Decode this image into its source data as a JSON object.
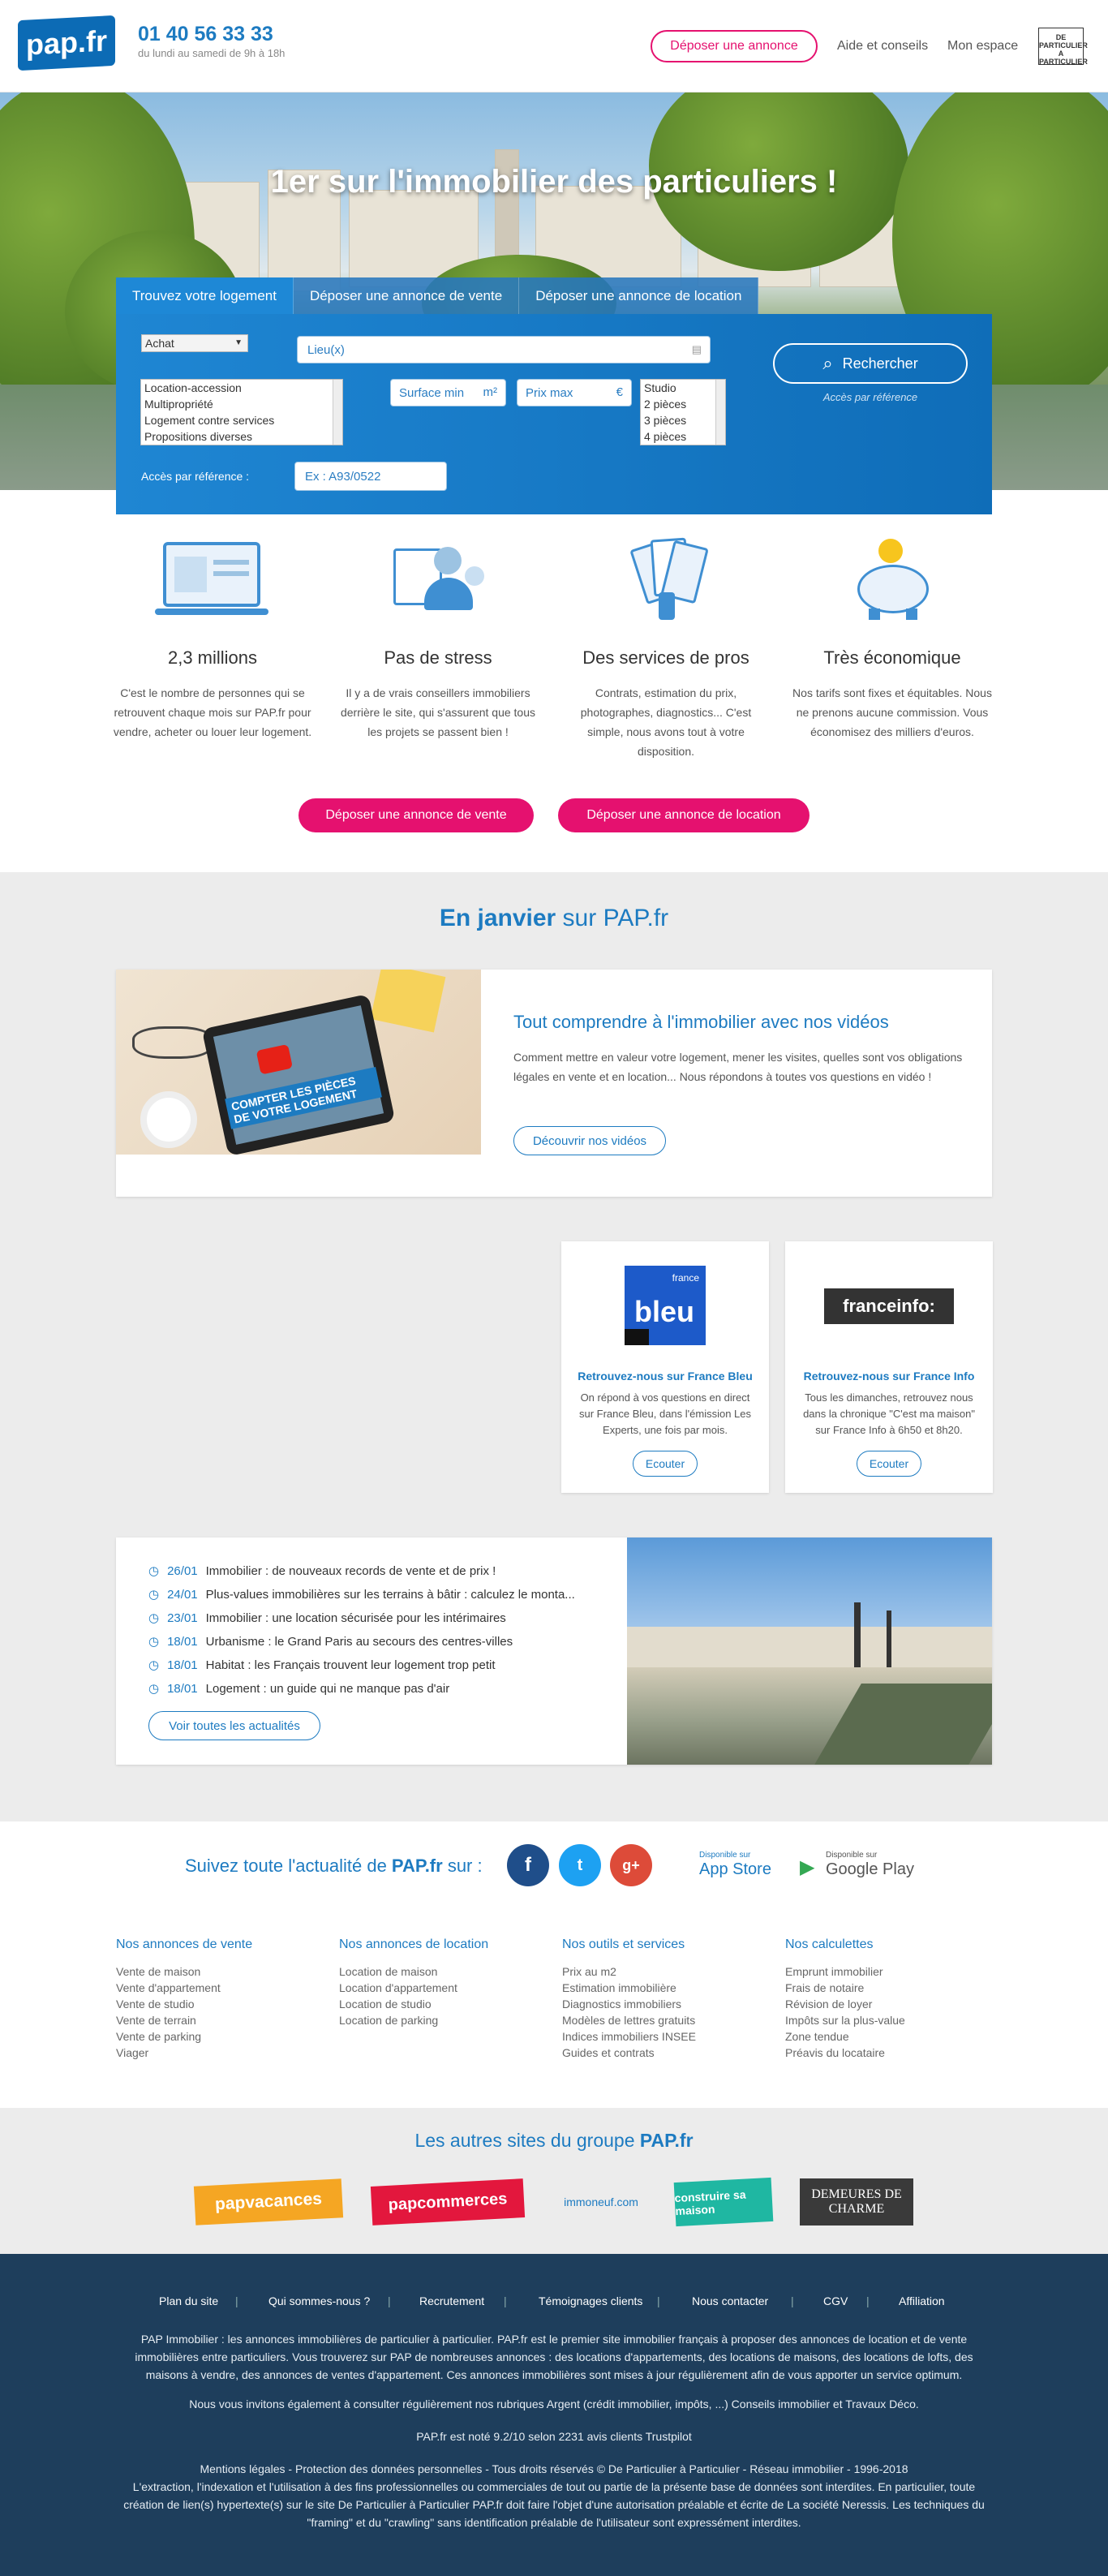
{
  "header": {
    "logo": "pap.fr",
    "phone": "01 40 56 33 33",
    "hours": "du lundi au samedi de 9h à 18h",
    "cta": "Déposer une annonce",
    "nav": [
      "Aide et conseils",
      "Mon espace"
    ],
    "badge": "DE PARTICULIER A PARTICULIER"
  },
  "hero": {
    "title": "1er sur l'immobilier des particuliers !",
    "tabs": [
      "Trouvez votre logement",
      "Déposer une annonce de vente",
      "Déposer une annonce de location"
    ],
    "type_select": "Achat",
    "location_placeholder": "Lieu(x)",
    "property_types": [
      "Location-accession",
      "Multipropriété",
      "Logement contre services",
      "Propositions diverses"
    ],
    "surface_placeholder": "Surface min",
    "surface_unit": "m²",
    "price_placeholder": "Prix max",
    "price_unit": "€",
    "rooms": [
      "Studio",
      "2 pièces",
      "3 pièces",
      "4 pièces"
    ],
    "search_button": "Rechercher",
    "ref_link": "Accès par référence",
    "ref_label": "Accès par référence :",
    "ref_placeholder": "Ex : A93/0522"
  },
  "features": [
    {
      "title": "2,3 millions",
      "text": "C'est le nombre de personnes qui se retrouvent chaque mois sur PAP.fr pour vendre, acheter ou louer leur logement."
    },
    {
      "title": "Pas de stress",
      "text": "Il y a de vrais conseillers immobiliers derrière le site, qui s'assurent que tous les projets se passent bien !"
    },
    {
      "title": "Des services de pros",
      "text": "Contrats, estimation du prix, photographes, diagnostics... C'est simple, nous avons tout à votre disposition."
    },
    {
      "title": "Très économique",
      "text": "Nos tarifs sont fixes et équitables. Nous ne prenons aucune commission. Vous économisez des milliers d'euros."
    }
  ],
  "cta_buttons": [
    "Déposer une annonce de vente",
    "Déposer une annonce de location"
  ],
  "january": {
    "title_bold": "En janvier",
    "title_rest": " sur PAP.fr",
    "video_overlay": "COMPTER LES PIÈCES DE VOTRE LOGEMENT",
    "video_title": "Tout comprendre à l'immobilier avec nos vidéos",
    "video_text": "Comment mettre en valeur votre logement, mener les visites, quelles sont vos obligations légales en vente et en location... Nous répondons à toutes vos questions en vidéo !",
    "video_button": "Découvrir nos vidéos"
  },
  "radio": [
    {
      "logo_top": "france",
      "logo": "bleu",
      "title": "Retrouvez-nous sur France Bleu",
      "text": "On répond à vos questions en direct sur France Bleu, dans l'émission Les Experts, une fois par mois.",
      "button": "Ecouter"
    },
    {
      "logo": "franceinfo:",
      "title": "Retrouvez-nous sur France Info",
      "text": "Tous les dimanches, retrouvez nous dans la chronique \"C'est ma maison\" sur France Info à 6h50 et 8h20.",
      "button": "Ecouter"
    }
  ],
  "news": {
    "items": [
      {
        "date": "26/01",
        "title": "Immobilier : de nouveaux records de vente et de prix !"
      },
      {
        "date": "24/01",
        "title": "Plus-values immobilières sur les terrains à bâtir : calculez le monta..."
      },
      {
        "date": "23/01",
        "title": "Immobilier : une location sécurisée pour les intérimaires"
      },
      {
        "date": "18/01",
        "title": "Urbanisme : le Grand Paris au secours des centres-villes"
      },
      {
        "date": "18/01",
        "title": "Habitat : les Français trouvent leur logement trop petit"
      },
      {
        "date": "18/01",
        "title": "Logement : un guide qui ne manque pas d'air"
      }
    ],
    "button": "Voir toutes les actualités"
  },
  "follow": {
    "text": "Suivez toute l'actualité de ",
    "brand": "PAP.fr",
    "suffix": " sur :",
    "appstore_small": "Disponible sur",
    "appstore": "App Store",
    "googleplay_small": "Disponible sur",
    "googleplay": "Google Play"
  },
  "footer_cols": [
    {
      "title": "Nos annonces de vente",
      "links": [
        "Vente de maison",
        "Vente d'appartement",
        "Vente de studio",
        "Vente de terrain",
        "Vente de parking",
        "Viager"
      ]
    },
    {
      "title": "Nos annonces de location",
      "links": [
        "Location de maison",
        "Location d'appartement",
        "Location de studio",
        "Location de parking"
      ]
    },
    {
      "title": "Nos outils et services",
      "links": [
        "Prix au m2",
        "Estimation immobilière",
        "Diagnostics immobiliers",
        "Modèles de lettres gratuits",
        "Indices immobiliers INSEE",
        "Guides et contrats"
      ]
    },
    {
      "title": "Nos calculettes",
      "links": [
        "Emprunt immobilier",
        "Frais de notaire",
        "Révision de loyer",
        "Impôts sur la plus-value",
        "Zone tendue",
        "Préavis du locataire"
      ]
    }
  ],
  "group": {
    "title_rest": "Les autres sites du groupe ",
    "title_brand": "PAP.fr",
    "sites": [
      "papvacances",
      "papcommerces",
      "immoneuf.com",
      "construire sa maison",
      "DEMEURES DE CHARME"
    ]
  },
  "bottom": {
    "nav": [
      "Plan du site",
      "Qui sommes-nous ?",
      "Recrutement",
      "Témoignages clients",
      "Nous contacter",
      "CGV",
      "Affiliation"
    ],
    "para1": "PAP Immobilier : les annonces immobilières de particulier à particulier. PAP.fr est le premier site immobilier français à proposer des annonces de location et de vente immobilières entre particuliers. Vous trouverez sur PAP de nombreuses annonces : des locations d'appartements, des locations de maisons, des locations de lofts, des maisons à vendre, des annonces de ventes d'appartement. Ces annonces immobilières sont mises à jour régulièrement afin de vous apporter un service optimum.",
    "para2": "Nous vous invitons également à consulter régulièrement nos rubriques Argent (crédit immobilier, impôts, ...) Conseils immobilier et Travaux Déco.",
    "para3": "PAP.fr est noté 9.2/10 selon 2231 avis clients Trustpilot",
    "para4": "Mentions légales - Protection des données personnelles - Tous droits réservés © De Particulier à Particulier - Réseau immobilier - 1996-2018",
    "para5": "L'extraction, l'indexation et l'utilisation à des fins professionnelles ou commerciales de tout ou partie de la présente base de données sont interdites. En particulier, toute création de lien(s) hypertexte(s) sur le site De Particulier à Particulier PAP.fr doit faire l'objet d'une autorisation préalable et écrite de La société Neressis. Les techniques du \"framing\" et du \"crawling\" sans identification préalable de l'utilisateur sont expressément interdites."
  },
  "colors": {
    "brand_blue": "#1d7bc1",
    "pink": "#e5116f",
    "footer": "#1e3e5c"
  }
}
